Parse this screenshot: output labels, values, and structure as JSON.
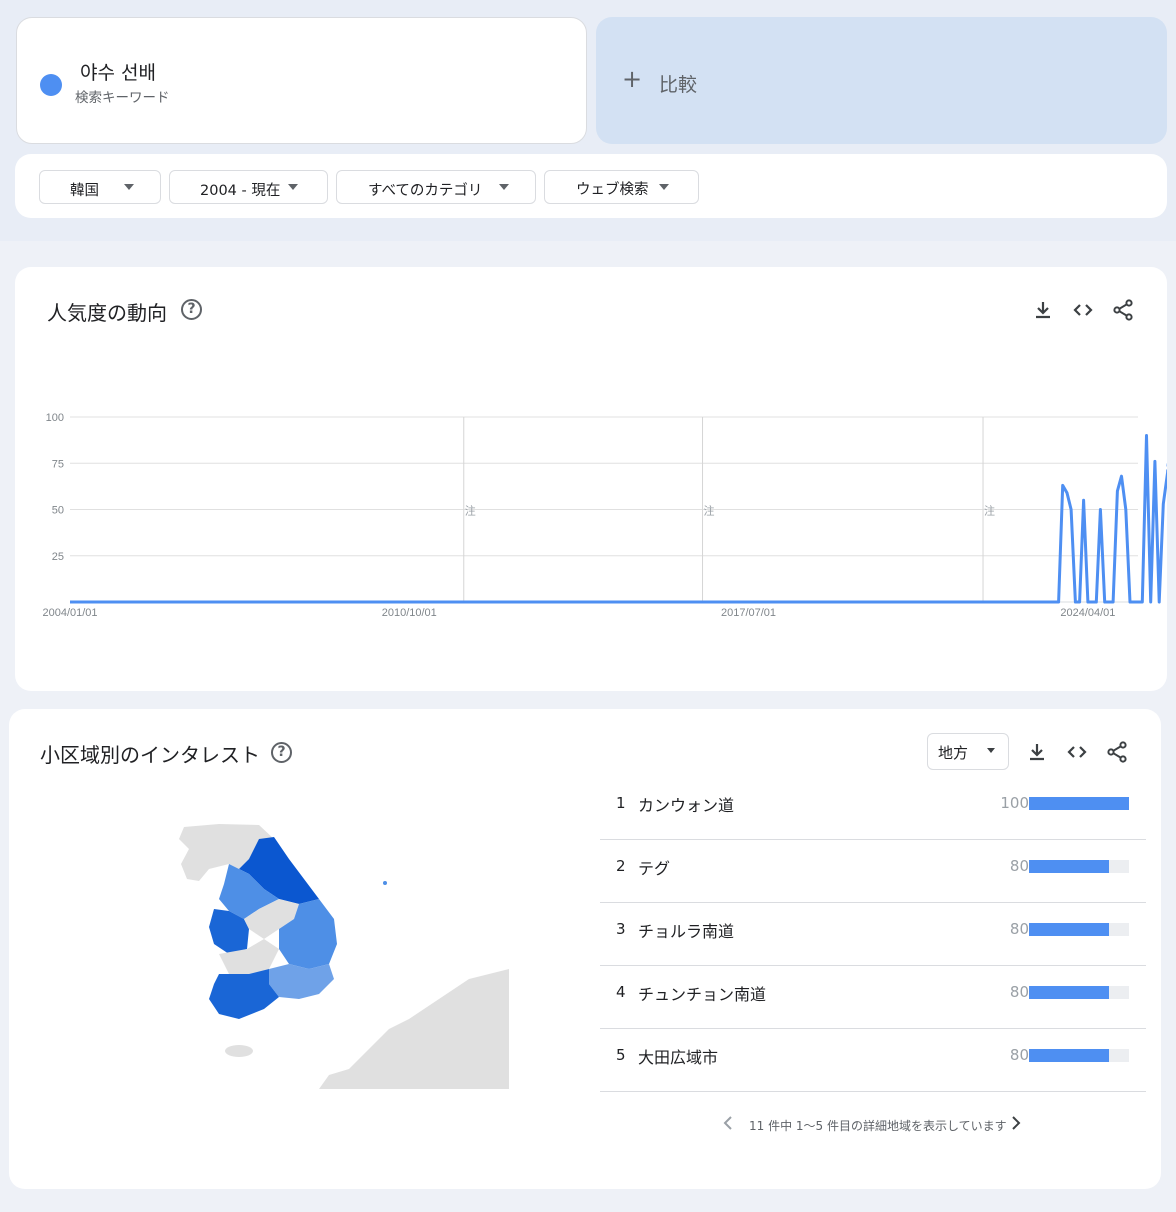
{
  "search_term": {
    "title": "야수 선배",
    "subtitle": "検索キーワード",
    "color": "#4e8ff2"
  },
  "compare": {
    "label": "比較"
  },
  "filters": [
    {
      "label": "韓国"
    },
    {
      "label": "2004 - 現在"
    },
    {
      "label": "すべてのカテゴリ"
    },
    {
      "label": "ウェブ検索"
    }
  ],
  "trend": {
    "title": "人気度の動向",
    "tools": [
      "download-icon",
      "embed-icon",
      "share-icon"
    ],
    "note_label": "注"
  },
  "chart_data": {
    "type": "line",
    "title": "",
    "xlabel": "",
    "ylabel": "",
    "ylim": [
      0,
      100
    ],
    "yticks": [
      25,
      50,
      75,
      100
    ],
    "x_range": [
      "2004-01-01",
      "2025-03-31"
    ],
    "x_ticks": [
      "2004/01/01",
      "2010/10/01",
      "2017/07/01",
      "2024/04/01"
    ],
    "annotations": [
      "2011-11-01",
      "2016-08-01",
      "2022-03-01"
    ],
    "grid": true,
    "color": "#4e8ff2",
    "series": [
      {
        "name": "",
        "points": [
          [
            "2004-01-01",
            0
          ],
          [
            "2023-09-01",
            0
          ],
          [
            "2023-10-01",
            63
          ],
          [
            "2023-11-01",
            59
          ],
          [
            "2023-12-01",
            50
          ],
          [
            "2024-01-01",
            0
          ],
          [
            "2024-02-01",
            0
          ],
          [
            "2024-03-01",
            55
          ],
          [
            "2024-04-01",
            0
          ],
          [
            "2024-05-01",
            0
          ],
          [
            "2024-06-01",
            0
          ],
          [
            "2024-07-01",
            50
          ],
          [
            "2024-08-01",
            0
          ],
          [
            "2024-09-01",
            0
          ],
          [
            "2024-10-01",
            0
          ],
          [
            "2024-11-01",
            60
          ],
          [
            "2024-12-01",
            68
          ],
          [
            "2025-01-01",
            50
          ],
          [
            "2025-02-01",
            0
          ],
          [
            "2025-03-01",
            0
          ],
          [
            "2025-04-01",
            0
          ],
          [
            "2025-05-01",
            0
          ],
          [
            "2025-06-01",
            90
          ],
          [
            "2025-07-01",
            0
          ],
          [
            "2025-08-01",
            76
          ],
          [
            "2025-09-01",
            0
          ],
          [
            "2025-10-01",
            53
          ],
          [
            "2025-11-01",
            70
          ]
        ],
        "partial": [
          [
            "2025-11-01",
            70
          ],
          [
            "2025-12-01",
            100
          ]
        ]
      }
    ]
  },
  "region": {
    "title": "小区域別のインタレスト",
    "dropdown": "地方",
    "rows": [
      {
        "rank": "1",
        "name": "カンウォン道",
        "value": 100
      },
      {
        "rank": "2",
        "name": "テグ",
        "value": 80
      },
      {
        "rank": "3",
        "name": "チョルラ南道",
        "value": 80
      },
      {
        "rank": "4",
        "name": "チュンチョン南道",
        "value": 80
      },
      {
        "rank": "5",
        "name": "大田広域市",
        "value": 80
      }
    ],
    "pager_text": "11 件中 1〜5 件目の詳細地域を表示しています",
    "map_colors": {
      "land": "#e0e0e0",
      "dark": "#0b57d0",
      "mid": "#1a66d6",
      "light": "#4e8fe6",
      "lighter": "#6fa2e8"
    }
  }
}
